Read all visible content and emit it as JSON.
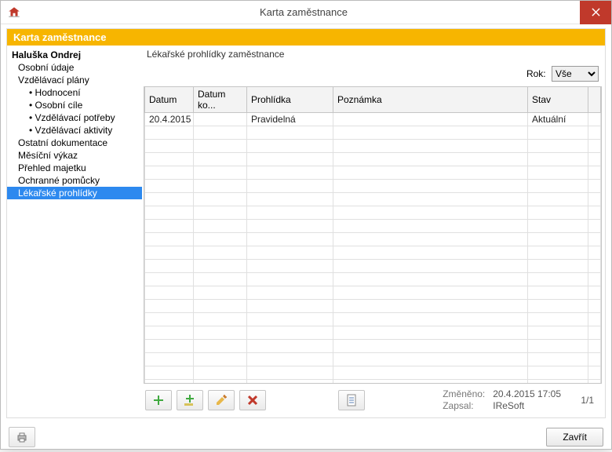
{
  "window": {
    "title": "Karta zaměstnance"
  },
  "header_bar": "Karta zaměstnance",
  "sidebar": {
    "root": "Haluška Ondrej",
    "items": [
      {
        "label": "Osobní údaje",
        "level": 1,
        "sub": false
      },
      {
        "label": "Vzdělávací plány",
        "level": 1,
        "sub": false
      },
      {
        "label": "Hodnocení",
        "level": 2,
        "sub": true
      },
      {
        "label": "Osobní cíle",
        "level": 2,
        "sub": true
      },
      {
        "label": "Vzdělávací potřeby",
        "level": 2,
        "sub": true
      },
      {
        "label": "Vzdělávací aktivity",
        "level": 2,
        "sub": true
      },
      {
        "label": "Ostatní dokumentace",
        "level": 1,
        "sub": false
      },
      {
        "label": "Měsíční výkaz",
        "level": 1,
        "sub": false
      },
      {
        "label": "Přehled majetku",
        "level": 1,
        "sub": false
      },
      {
        "label": "Ochranné pomůcky",
        "level": 1,
        "sub": false
      },
      {
        "label": "Lékařské prohlídky",
        "level": 1,
        "sub": false,
        "selected": true
      }
    ]
  },
  "main": {
    "heading": "Lékařské prohlídky zaměstnance",
    "year_label": "Rok:",
    "year_value": "Vše",
    "columns": {
      "datum": "Datum",
      "datum_ko": "Datum ko...",
      "prohlidka": "Prohlídka",
      "poznamka": "Poznámka",
      "stav": "Stav"
    },
    "rows": [
      {
        "datum": "20.4.2015",
        "datum_ko": "",
        "prohlidka": "Pravidelná",
        "poznamka": "",
        "stav": "Aktuální"
      }
    ]
  },
  "toolbar": {
    "add": "add-icon",
    "add_with": "add-with-icon",
    "edit": "edit-icon",
    "delete": "delete-icon",
    "document": "document-icon"
  },
  "meta": {
    "changed_label": "Změněno:",
    "changed_value": "20.4.2015 17:05",
    "author_label": "Zapsal:",
    "author_value": "IReSoft",
    "page": "1/1"
  },
  "footer": {
    "close_label": "Zavřít"
  }
}
